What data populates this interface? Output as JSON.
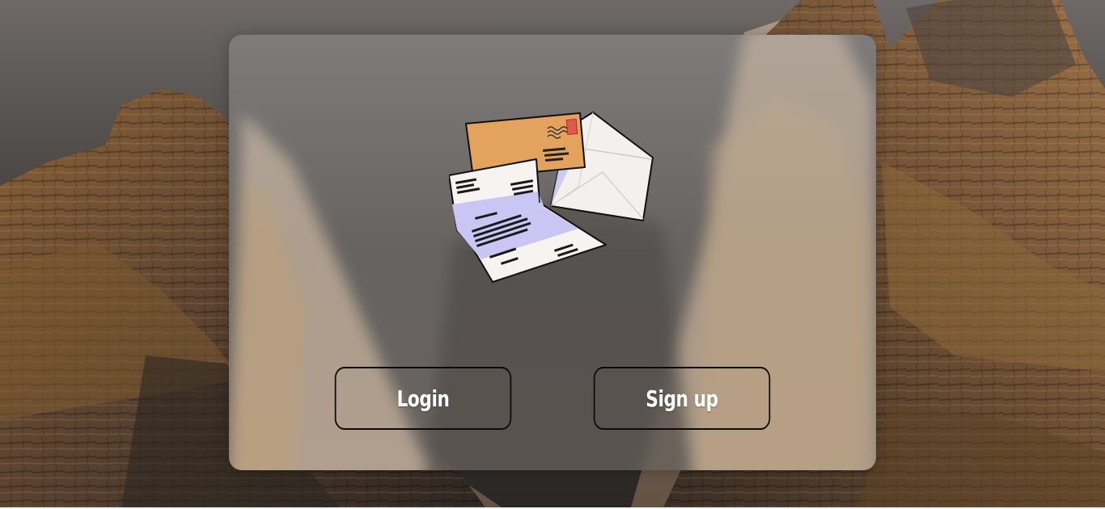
{
  "auth": {
    "login_label": "Login",
    "signup_label": "Sign up"
  },
  "illustration": {
    "icon": "mail-envelopes-icon"
  },
  "colors": {
    "button_border": "#0b0b0b",
    "button_text": "#ffffff",
    "envelope_orange": "#e3a35f",
    "letter_lavender": "#c9c6f4"
  }
}
